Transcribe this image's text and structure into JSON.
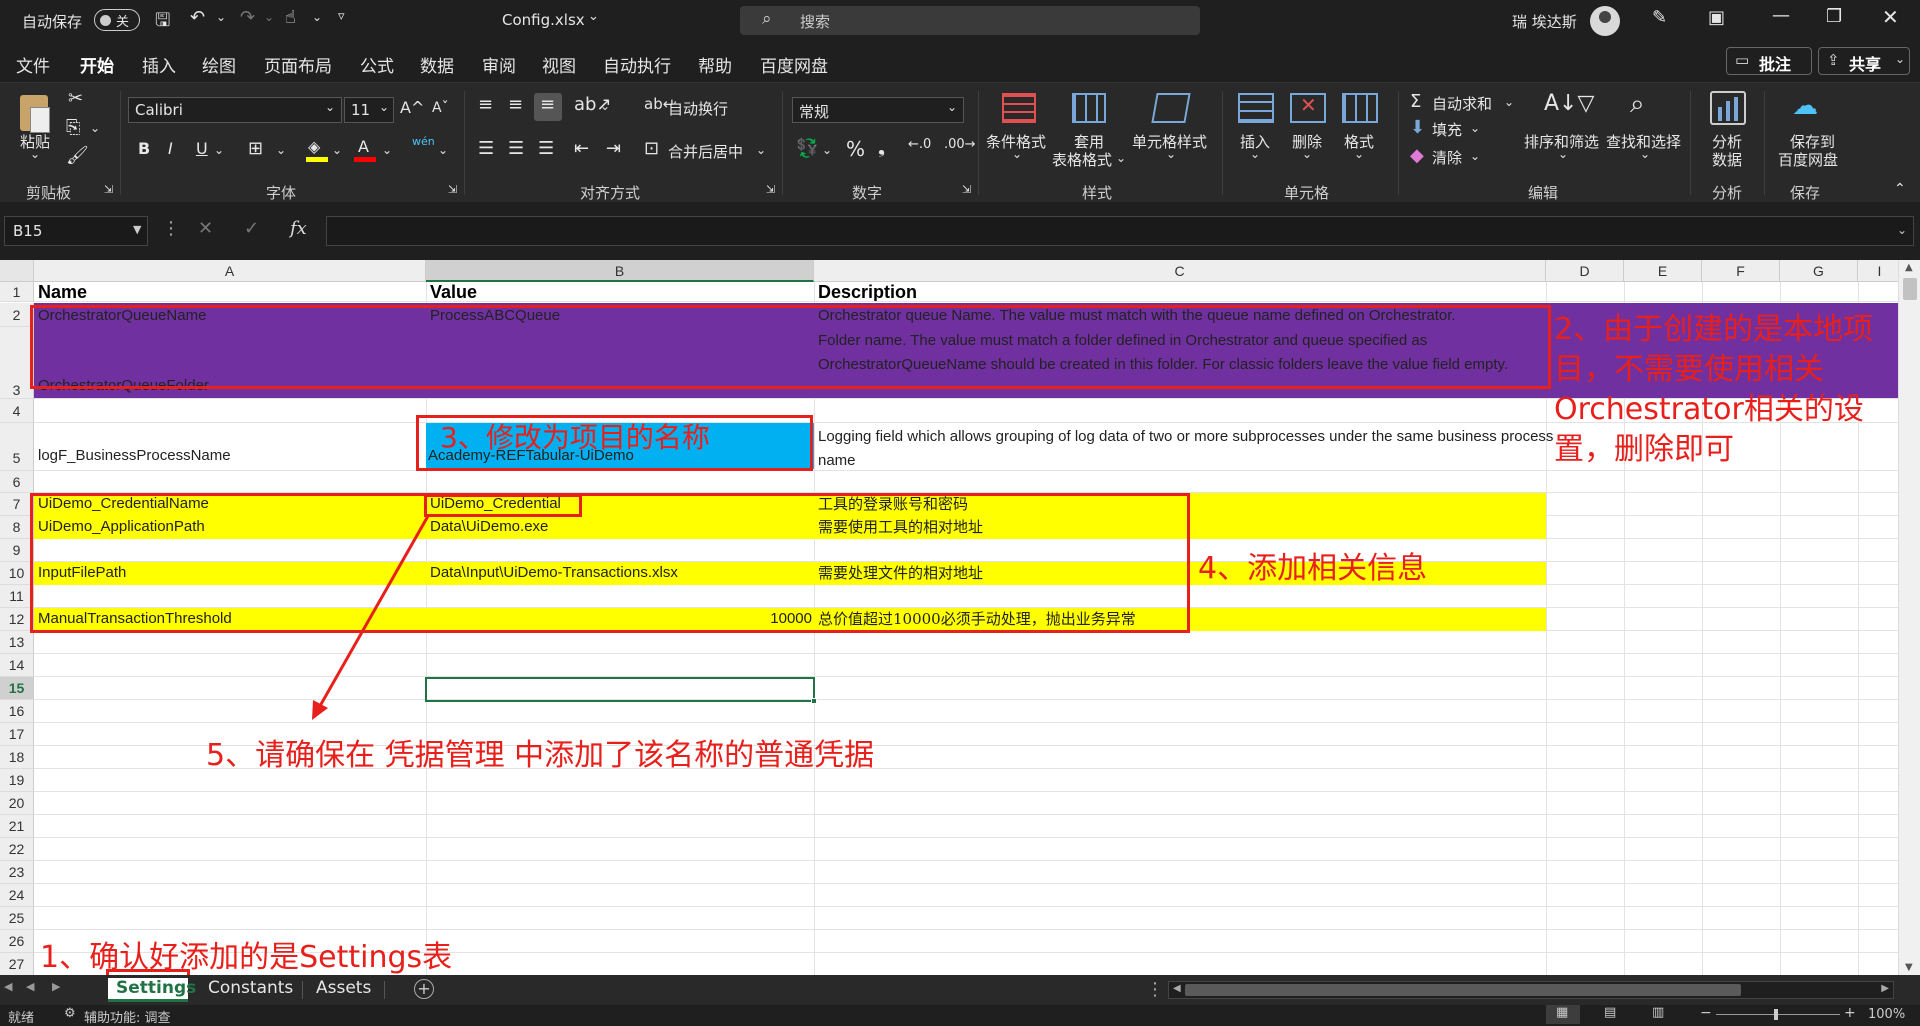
{
  "titlebar": {
    "autosave_label": "自动保存",
    "autosave_state": "关",
    "filename": "Config.xlsx",
    "search_placeholder": "搜索",
    "user_name": "瑞 埃达斯"
  },
  "menu": [
    "文件",
    "开始",
    "插入",
    "绘图",
    "页面布局",
    "公式",
    "数据",
    "审阅",
    "视图",
    "自动执行",
    "帮助",
    "百度网盘"
  ],
  "menu_active_index": 1,
  "menu_right": {
    "comments": "批注",
    "share": "共享"
  },
  "ribbon": {
    "clipboard": {
      "paste": "粘贴",
      "group": "剪贴板"
    },
    "font": {
      "name": "Calibri",
      "size": "11",
      "group": "字体",
      "bold": "B",
      "italic": "I",
      "underline": "U",
      "phonetic": "wén"
    },
    "alignment": {
      "wrap": "自动换行",
      "merge": "合并后居中",
      "group": "对齐方式"
    },
    "number": {
      "format": "常规",
      "group": "数字"
    },
    "styles": {
      "conditional": "条件格式",
      "table1": "套用",
      "table2": "表格格式",
      "cell_styles": "单元格样式",
      "group": "样式"
    },
    "cells": {
      "insert": "插入",
      "delete": "删除",
      "format": "格式",
      "group": "单元格"
    },
    "editing": {
      "autosum": "自动求和",
      "fill": "填充",
      "clear": "清除",
      "sort": "排序和筛选",
      "find": "查找和选择",
      "group": "编辑"
    },
    "analysis": {
      "analyze1": "分析",
      "analyze2": "数据",
      "group": "分析"
    },
    "save": {
      "save1": "保存到",
      "save2": "百度网盘",
      "group": "保存"
    }
  },
  "formula_bar": {
    "name_box": "B15",
    "fx": "fx",
    "content": ""
  },
  "columns": [
    "A",
    "B",
    "C",
    "D",
    "E",
    "F",
    "G",
    "I"
  ],
  "rows": [
    {
      "n": "1",
      "a": "Name",
      "b": "Value",
      "c": "Description"
    },
    {
      "n": "2",
      "a": "OrchestratorQueueName",
      "b": "ProcessABCQueue",
      "c": "Orchestrator queue Name. The value must match with the queue name defined on Orchestrator."
    },
    {
      "n": "3",
      "a": "OrchestratorQueueFolder",
      "b": "",
      "c": "Folder name. The value must match a folder defined in Orchestrator and queue specified as OrchestratorQueueName should be created in this folder. For classic folders leave the value field empty."
    },
    {
      "n": "4",
      "a": "",
      "b": "",
      "c": ""
    },
    {
      "n": "5",
      "a": "logF_BusinessProcessName",
      "b": "Academy-REFTabular-UiDemo",
      "c": "Logging field which allows grouping of log data of two or more subprocesses under the same business process name"
    },
    {
      "n": "6",
      "a": "",
      "b": "",
      "c": ""
    },
    {
      "n": "7",
      "a": "UiDemo_CredentialName",
      "b": "UiDemo_Credential",
      "c": "工具的登录账号和密码"
    },
    {
      "n": "8",
      "a": "UiDemo_ApplicationPath",
      "b": "Data\\UiDemo.exe",
      "c": "需要使用工具的相对地址"
    },
    {
      "n": "9",
      "a": "",
      "b": "",
      "c": ""
    },
    {
      "n": "10",
      "a": "InputFilePath",
      "b": "Data\\Input\\UiDemo-Transactions.xlsx",
      "c": "需要处理文件的相对地址"
    },
    {
      "n": "11",
      "a": "",
      "b": "",
      "c": ""
    },
    {
      "n": "12",
      "a": "ManualTransactionThreshold",
      "b": "10000",
      "c": "总价值超过10000必须手动处理，抛出业务异常"
    },
    {
      "n": "13"
    },
    {
      "n": "14"
    },
    {
      "n": "15"
    },
    {
      "n": "16"
    },
    {
      "n": "17"
    },
    {
      "n": "18"
    },
    {
      "n": "19"
    },
    {
      "n": "20"
    },
    {
      "n": "21"
    },
    {
      "n": "22"
    },
    {
      "n": "23"
    },
    {
      "n": "24"
    },
    {
      "n": "25"
    },
    {
      "n": "26"
    },
    {
      "n": "27"
    }
  ],
  "annotations": {
    "a1": "1、确认好添加的是Settings表",
    "a2_line1": "2、由于创建的是本地项",
    "a2_line2": "目，不需要使用相关",
    "a2_line3": "Orchestrator相关的设",
    "a2_line4": "置，删除即可",
    "a3": "3、修改为项目的名称",
    "a4": "4、添加相关信息",
    "a5": "5、请确保在 凭据管理 中添加了该名称的普通凭据"
  },
  "sheets": [
    "Settings",
    "Constants",
    "Assets"
  ],
  "active_sheet": "Settings",
  "status": {
    "ready": "就绪",
    "accessibility": "辅助功能: 调查",
    "zoom": "100%"
  },
  "colors": {
    "purple": "#7030a0",
    "blue": "#00b0f0",
    "yellow": "#ffff00",
    "annotation_red": "#e8201c",
    "selection_green": "#217346"
  }
}
